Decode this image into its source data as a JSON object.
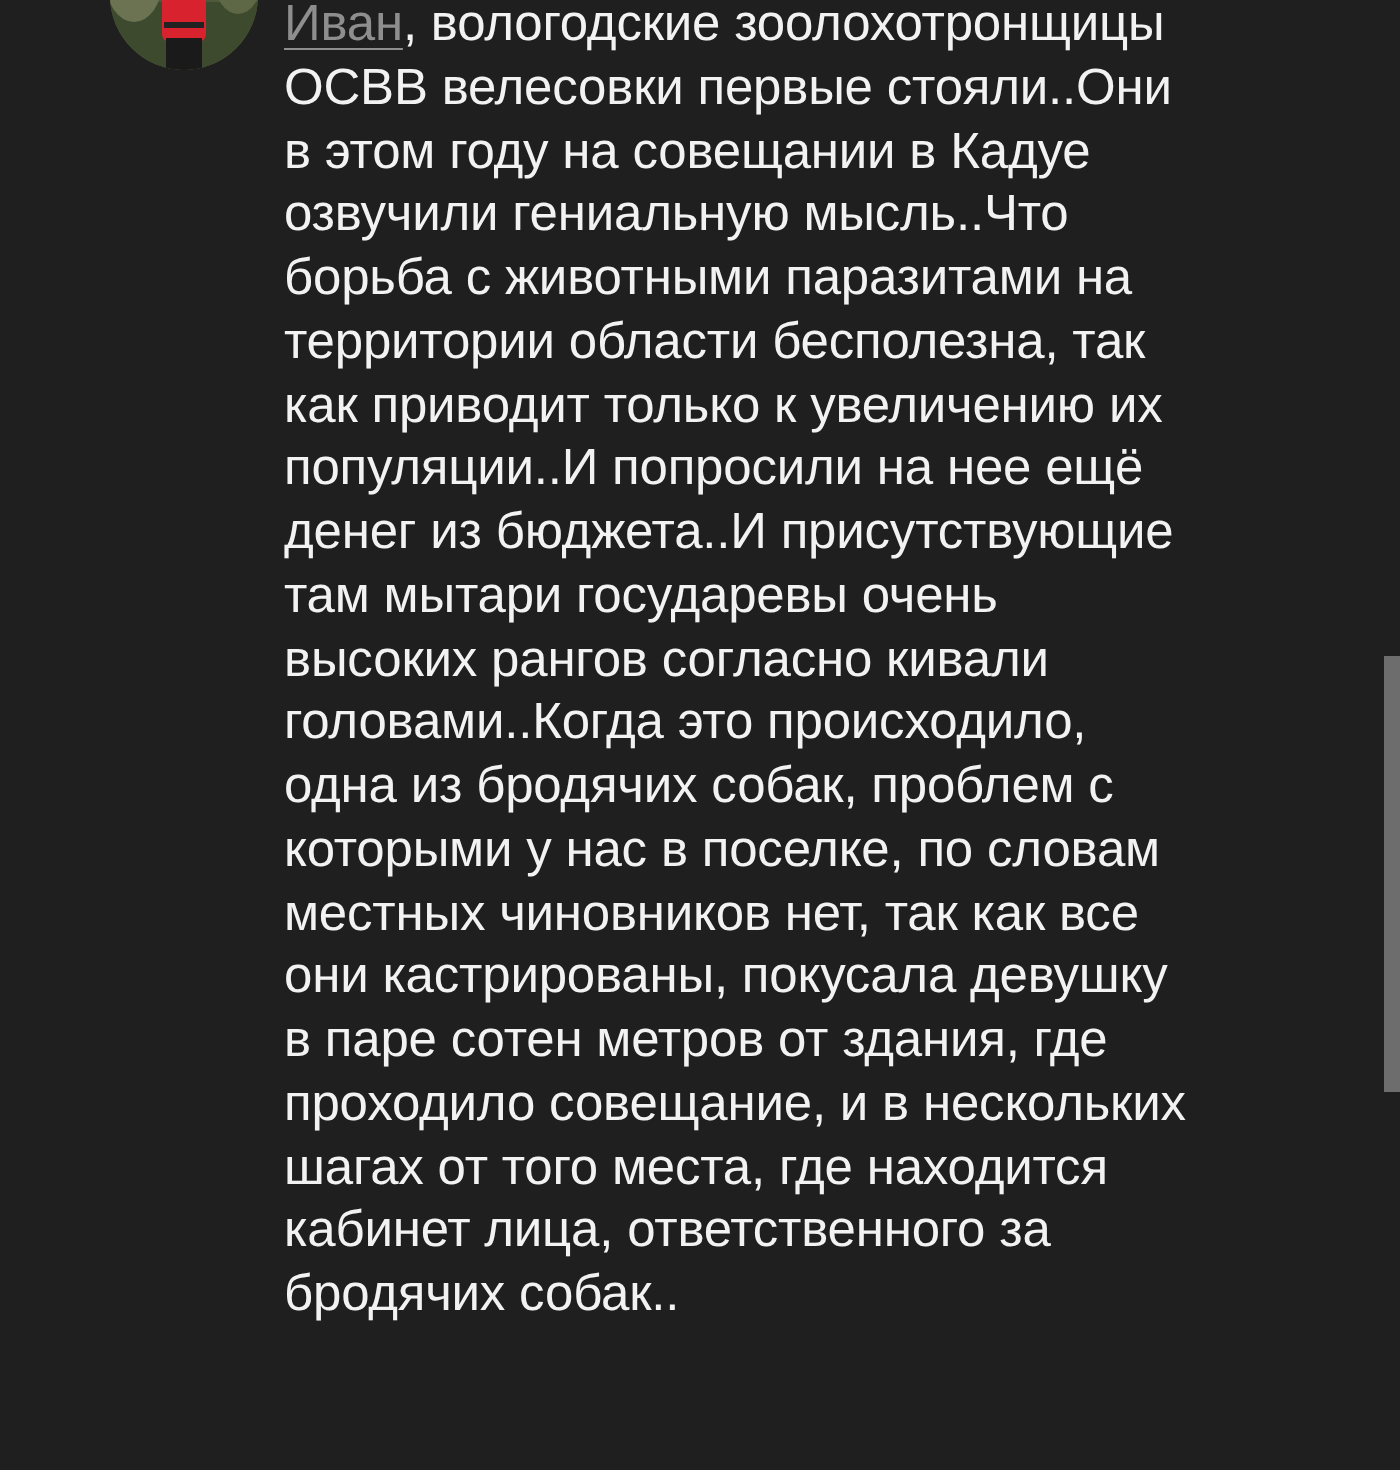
{
  "comment": {
    "author": "Иван",
    "lines": [
      ", вологодские зоолохотронщицы",
      "ОСВВ велесовки первые стояли..Они",
      "в этом году на совещании в Кадуе",
      "озвучили гениальную мысль..Что",
      "борьба с животными паразитами на",
      "территории области бесполезна, так",
      "как приводит только к увеличению их",
      "популяции..И попросили на нее ещё",
      "денег из бюджета..И присутствующие",
      "там мытари государевы очень",
      "высоких рангов согласно кивали",
      "головами..Когда это происходило,",
      "одна из бродячих собак, проблем с",
      "которыми у нас в поселке, по словам",
      "местных чиновников нет, так как все",
      "они кастрированы, покусала девушку",
      "в паре сотен метров от здания, где",
      "проходило совещание, и в нескольких",
      "шагах от того места, где находится",
      "кабинет лица, ответственного за",
      "бродячих собак.."
    ]
  }
}
